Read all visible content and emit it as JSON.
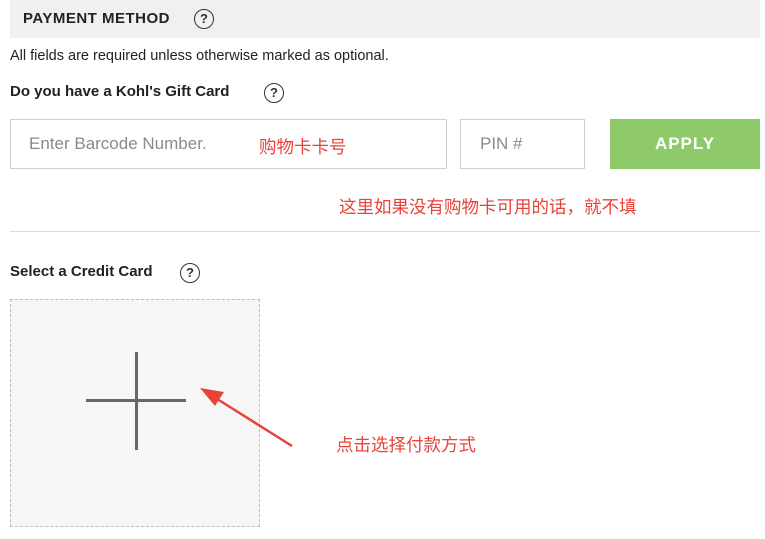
{
  "header": {
    "title": "PAYMENT METHOD",
    "help_glyph": "?"
  },
  "required_note": "All fields are required unless otherwise marked as optional.",
  "gift_card": {
    "question": "Do you have a Kohl's Gift Card",
    "help_glyph": "?",
    "barcode_placeholder": "Enter Barcode Number.",
    "pin_placeholder": "PIN #",
    "apply_label": "APPLY"
  },
  "annotations": {
    "gift_card_number": "购物卡卡号",
    "skip_if_none": "这里如果没有购物卡可用的话，就不填",
    "choose_payment": "点击选择付款方式"
  },
  "credit_card": {
    "heading": "Select a Credit Card",
    "help_glyph": "?",
    "add_icon": "plus-icon"
  },
  "colors": {
    "apply_button": "#8fca6a",
    "annotation": "#e8433a",
    "header_bg": "#f0f0f0"
  }
}
